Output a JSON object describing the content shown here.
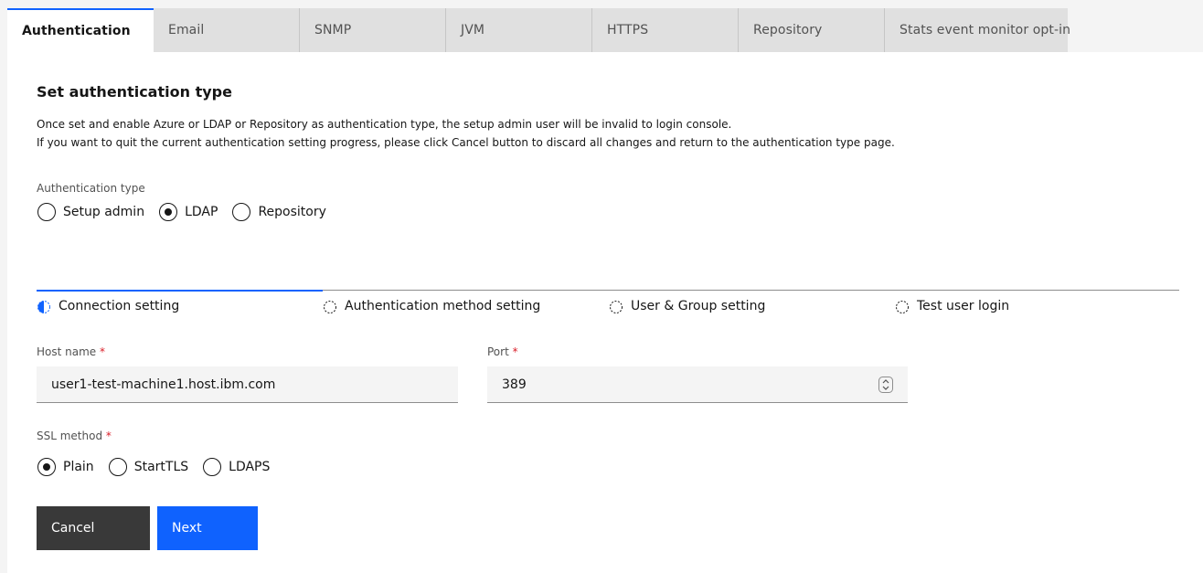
{
  "tabs": [
    {
      "label": "Authentication",
      "active": true
    },
    {
      "label": "Email",
      "active": false
    },
    {
      "label": "SNMP",
      "active": false
    },
    {
      "label": "JVM",
      "active": false
    },
    {
      "label": "HTTPS",
      "active": false
    },
    {
      "label": "Repository",
      "active": false
    },
    {
      "label": "Stats event monitor opt-in",
      "active": false
    }
  ],
  "section": {
    "title": "Set authentication type",
    "desc_line1": "Once set and enable Azure or LDAP or Repository as authentication type, the setup admin user will be invalid to login console.",
    "desc_line2": "If you want to quit the current authentication setting progress, please click Cancel button to discard all changes and return to the authentication type page."
  },
  "auth_type": {
    "label": "Authentication type",
    "options": [
      {
        "label": "Setup admin",
        "checked": false
      },
      {
        "label": "LDAP",
        "checked": true
      },
      {
        "label": "Repository",
        "checked": false
      }
    ]
  },
  "progress": {
    "steps": [
      {
        "label": "Connection setting",
        "state": "current"
      },
      {
        "label": "Authentication method setting",
        "state": "incomplete"
      },
      {
        "label": "User & Group setting",
        "state": "incomplete"
      },
      {
        "label": "Test user login",
        "state": "incomplete"
      }
    ]
  },
  "form": {
    "host": {
      "label": "Host name",
      "required_mark": "*",
      "value": "user1-test-machine1.host.ibm.com"
    },
    "port": {
      "label": "Port",
      "required_mark": "*",
      "value": "389"
    },
    "ssl": {
      "label": "SSL method",
      "required_mark": "*",
      "options": [
        {
          "label": "Plain",
          "checked": true
        },
        {
          "label": "StartTLS",
          "checked": false
        },
        {
          "label": "LDAPS",
          "checked": false
        }
      ]
    }
  },
  "buttons": {
    "cancel": "Cancel",
    "next": "Next"
  },
  "colors": {
    "accent": "#0f62fe",
    "dark_button": "#393939",
    "required": "#da1e28"
  }
}
